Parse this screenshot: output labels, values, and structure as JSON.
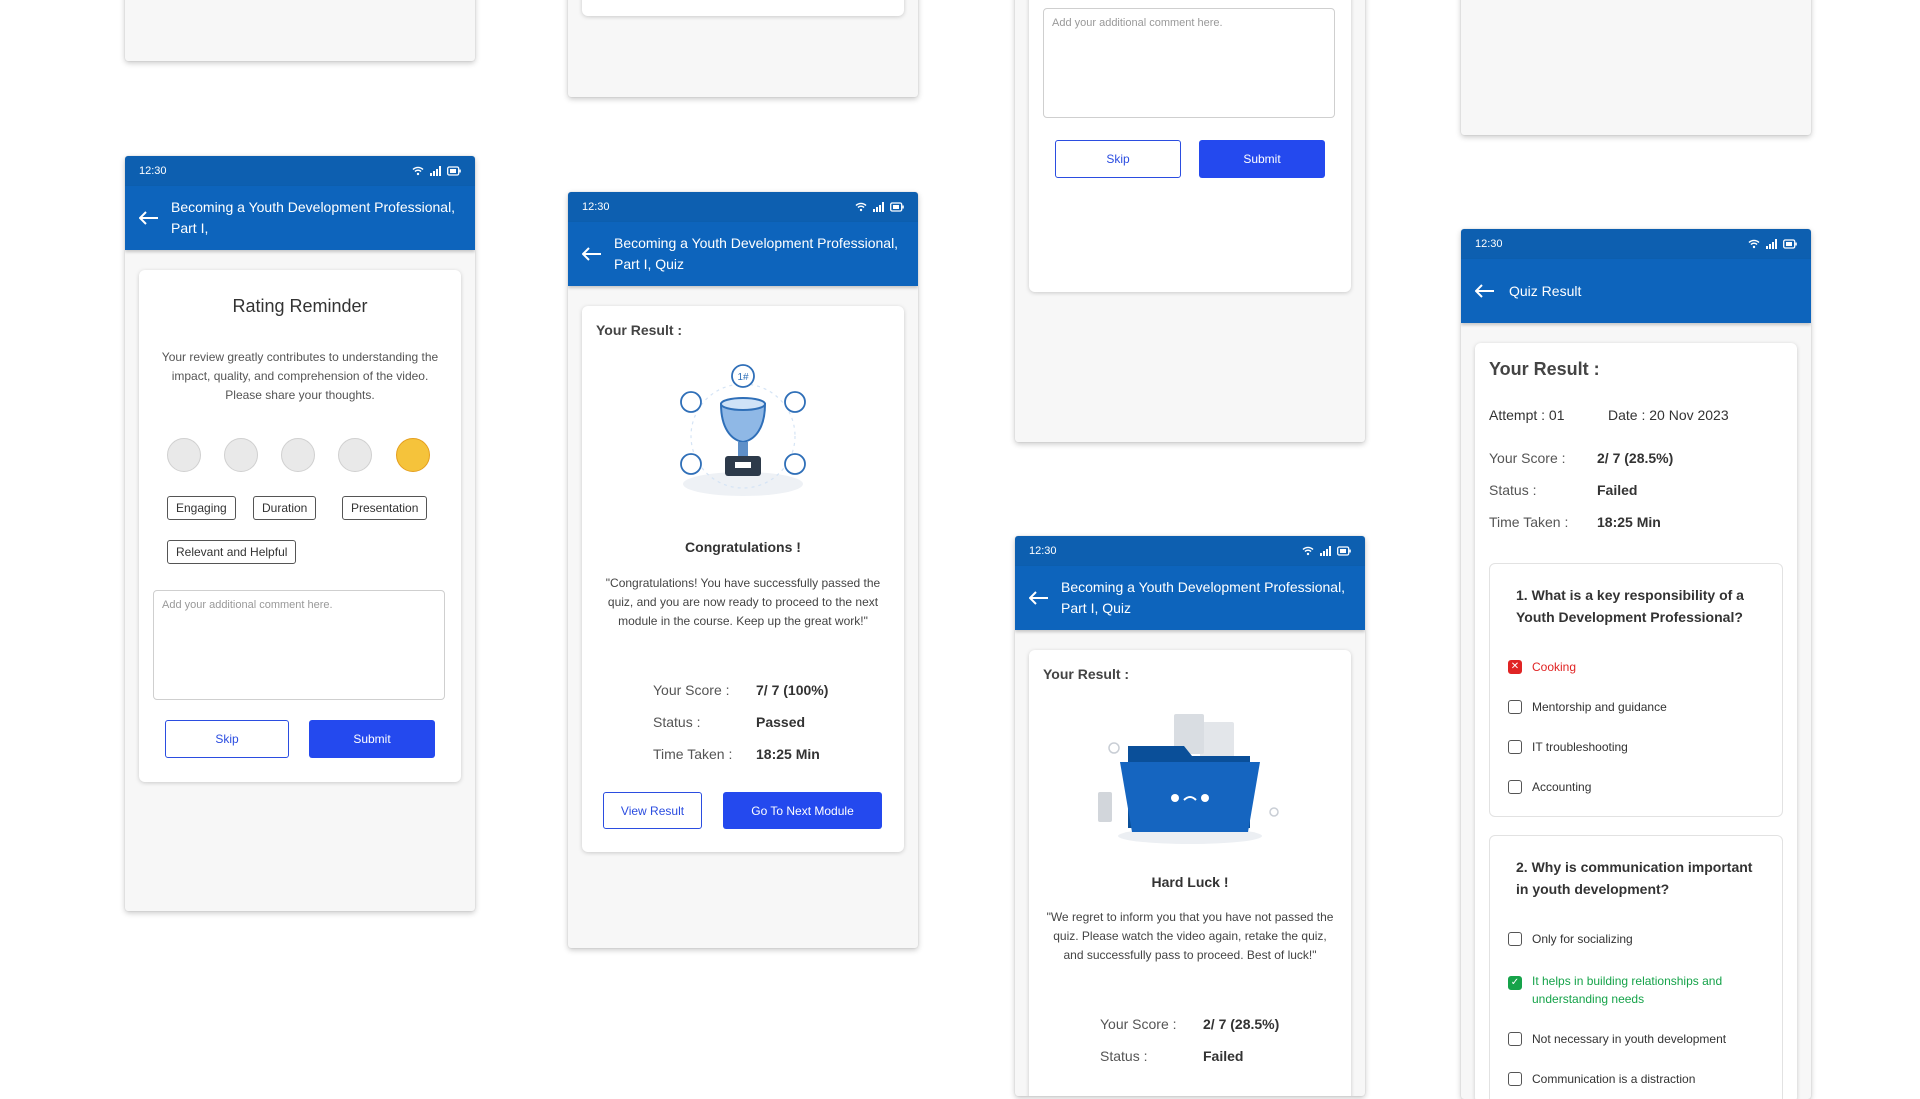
{
  "status_time": "12:30",
  "top_fragment": {
    "comment_placeholder": "Add your additional comment here.",
    "skip_label": "Skip",
    "submit_label": "Submit"
  },
  "rating_screen": {
    "app_title": "Becoming a Youth Development Professional, Part I,",
    "heading": "Rating Reminder",
    "description": "Your review greatly contributes to understanding the impact, quality, and comprehension of the video. Please share your thoughts.",
    "emojis": [
      "very-sad-face-icon",
      "sad-face-icon",
      "neutral-face-icon",
      "happy-face-icon",
      "love-face-icon"
    ],
    "tags": [
      "Engaging",
      "Duration",
      "Presentation",
      "Relevant and Helpful"
    ],
    "comment_placeholder": "Add your additional comment here.",
    "skip_label": "Skip",
    "submit_label": "Submit"
  },
  "pass_screen": {
    "app_title": "Becoming a Youth Development Professional, Part I, Quiz",
    "result_heading": "Your Result :",
    "title": "Congratulations !",
    "message": "\"Congratulations! You have successfully passed the quiz, and you are now ready to proceed to the next module in the course. Keep up the great work!\"",
    "score_label": "Your Score :",
    "score_value": "7/ 7 (100%)",
    "status_label": "Status :",
    "status_value": "Passed",
    "time_label": "Time Taken :",
    "time_value": "18:25 Min",
    "view_result_label": "View Result",
    "next_module_label": "Go To Next Module"
  },
  "fail_screen": {
    "app_title": "Becoming a Youth Development Professional, Part I, Quiz",
    "result_heading": "Your Result :",
    "title": "Hard Luck !",
    "message": "\"We regret to inform you that you have not passed the quiz. Please watch the video again, retake the quiz, and successfully pass to proceed. Best of luck!\"",
    "score_label": "Your Score :",
    "score_value": "2/ 7 (28.5%)",
    "status_label": "Status :",
    "status_value": "Failed"
  },
  "quiz_result_screen": {
    "app_title": "Quiz Result",
    "result_heading": "Your Result :",
    "attempt": "Attempt : 01",
    "date": "Date : 20 Nov 2023",
    "score_label": "Your Score :",
    "score_value": "2/ 7 (28.5%)",
    "status_label": "Status :",
    "status_value": "Failed",
    "time_label": "Time Taken :",
    "time_value": "18:25 Min",
    "questions": [
      {
        "text": "1. What is a key responsibility of a Youth Development Professional?",
        "options": [
          "Cooking",
          "Mentorship and guidance",
          "IT troubleshooting",
          "Accounting"
        ]
      },
      {
        "text": "2. Why is communication important in youth development?",
        "options": [
          "Only for socializing",
          "It helps in building relationships and understanding needs",
          "Not necessary in youth development",
          "Communication is a distraction"
        ]
      }
    ]
  },
  "colors": {
    "primary": "#0d64bc",
    "button": "#2449ee",
    "wrong": "#e02424",
    "correct": "#16a34a"
  }
}
